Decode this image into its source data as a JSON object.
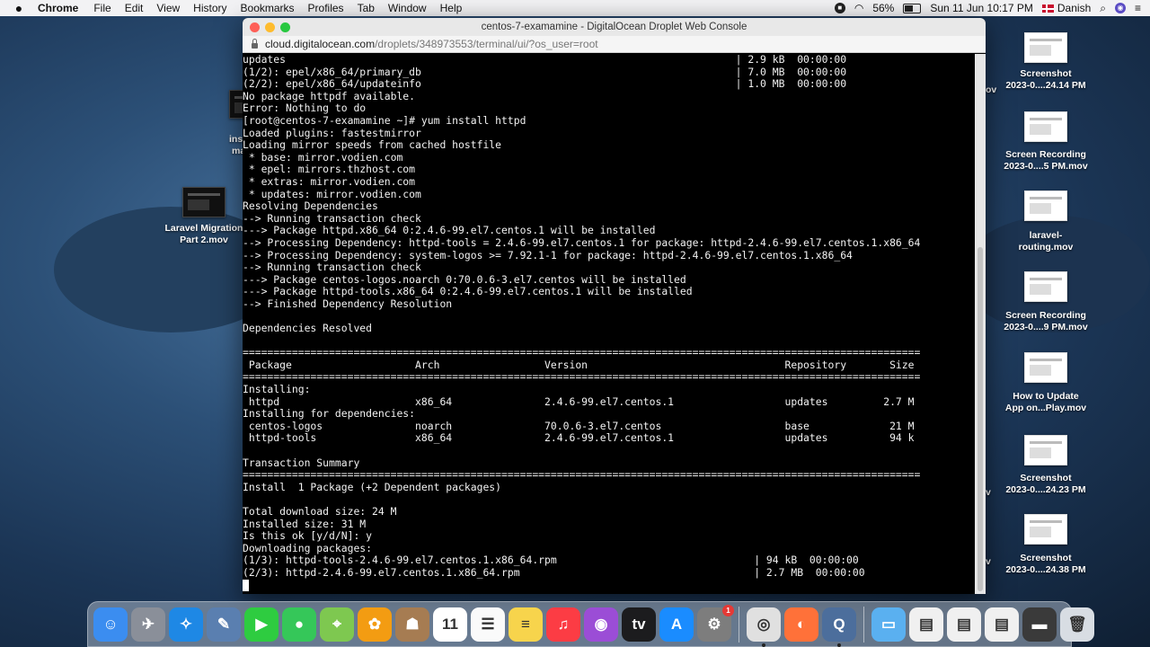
{
  "menubar": {
    "apple_icon": "apple-logo",
    "app_name": "Chrome",
    "menus": [
      "File",
      "Edit",
      "View",
      "History",
      "Bookmarks",
      "Profiles",
      "Tab",
      "Window",
      "Help"
    ],
    "battery": "56%",
    "datetime": "Sun 11 Jun  10:17 PM",
    "input_source": "Danish"
  },
  "window": {
    "title": "centos-7-examamine - DigitalOcean Droplet Web Console",
    "url_host": "cloud.digitalocean.com",
    "url_path": "/droplets/348973553/terminal/ui/?os_user=root"
  },
  "terminal": {
    "lines": [
      "updates                                                                         | 2.9 kB  00:00:00",
      "(1/2): epel/x86_64/primary_db                                                   | 7.0 MB  00:00:00",
      "(2/2): epel/x86_64/updateinfo                                                   | 1.0 MB  00:00:00",
      "No package httpdf available.",
      "Error: Nothing to do",
      "[root@centos-7-examamine ~]# yum install httpd",
      "Loaded plugins: fastestmirror",
      "Loading mirror speeds from cached hostfile",
      " * base: mirror.vodien.com",
      " * epel: mirrors.thzhost.com",
      " * extras: mirror.vodien.com",
      " * updates: mirror.vodien.com",
      "Resolving Dependencies",
      "--> Running transaction check",
      "---> Package httpd.x86_64 0:2.4.6-99.el7.centos.1 will be installed",
      "--> Processing Dependency: httpd-tools = 2.4.6-99.el7.centos.1 for package: httpd-2.4.6-99.el7.centos.1.x86_64",
      "--> Processing Dependency: system-logos >= 7.92.1-1 for package: httpd-2.4.6-99.el7.centos.1.x86_64",
      "--> Running transaction check",
      "---> Package centos-logos.noarch 0:70.0.6-3.el7.centos will be installed",
      "---> Package httpd-tools.x86_64 0:2.4.6-99.el7.centos.1 will be installed",
      "--> Finished Dependency Resolution",
      "",
      "Dependencies Resolved",
      "",
      "==============================================================================================================",
      " Package                    Arch                 Version                                Repository       Size",
      "==============================================================================================================",
      "Installing:",
      " httpd                      x86_64               2.4.6-99.el7.centos.1                  updates         2.7 M",
      "Installing for dependencies:",
      " centos-logos               noarch               70.0.6-3.el7.centos                    base             21 M",
      " httpd-tools                x86_64               2.4.6-99.el7.centos.1                  updates          94 k",
      "",
      "Transaction Summary",
      "==============================================================================================================",
      "Install  1 Package (+2 Dependent packages)",
      "",
      "Total download size: 24 M",
      "Installed size: 31 M",
      "Is this ok [y/d/N]: y",
      "Downloading packages:",
      "(1/3): httpd-tools-2.4.6-99.el7.centos.1.x86_64.rpm                                | 94 kB  00:00:00",
      "(2/3): httpd-2.4.6-99.el7.centos.1.x86_64.rpm                                      | 2.7 MB  00:00:00"
    ]
  },
  "desktop": {
    "left_items": [
      {
        "label1": "Laravel Migration",
        "label2": "Part 2.mov"
      }
    ],
    "left_partial": [
      "ins",
      "ma"
    ],
    "right_items": [
      {
        "label1": "Screenshot",
        "label2": "2023-0....24.14 PM"
      },
      {
        "label1": "Screen Recording",
        "label2": "2023-0....5 PM.mov"
      },
      {
        "label1": "laravel-",
        "label2": "routing.mov"
      },
      {
        "label1": "Screen Recording",
        "label2": "2023-0....9 PM.mov"
      },
      {
        "label1": "How to Update",
        "label2": "App on...Play.mov"
      },
      {
        "label1": "Screenshot",
        "label2": "2023-0....24.23 PM"
      },
      {
        "label1": "Screenshot",
        "label2": "2023-0....24.38 PM"
      }
    ],
    "right_partial": [
      "ov",
      "v",
      "v"
    ]
  },
  "dock": {
    "apps": [
      {
        "name": "finder-icon",
        "color": "#3b8df0",
        "glyph": "☺"
      },
      {
        "name": "launchpad-icon",
        "color": "#8a8f99",
        "glyph": "✈"
      },
      {
        "name": "safari-icon",
        "color": "#1e88e5",
        "glyph": "✧"
      },
      {
        "name": "preview-icon",
        "color": "#5a7fb0",
        "glyph": "✎"
      },
      {
        "name": "facetime-icon",
        "color": "#2ecc40",
        "glyph": "▶"
      },
      {
        "name": "messages-icon",
        "color": "#35c759",
        "glyph": "●"
      },
      {
        "name": "maps-icon",
        "color": "#7ec850",
        "glyph": "⌖"
      },
      {
        "name": "photos-icon",
        "color": "#f39c12",
        "glyph": "✿"
      },
      {
        "name": "contacts-icon",
        "color": "#a67c52",
        "glyph": "☗"
      },
      {
        "name": "calendar-icon",
        "color": "#ffffff",
        "glyph": "11"
      },
      {
        "name": "reminders-icon",
        "color": "#fafafa",
        "glyph": "☰"
      },
      {
        "name": "notes-icon",
        "color": "#f7d44c",
        "glyph": "≡"
      },
      {
        "name": "music-icon",
        "color": "#fc3c44",
        "glyph": "♫"
      },
      {
        "name": "podcasts-icon",
        "color": "#9b4dd6",
        "glyph": "◉"
      },
      {
        "name": "tv-icon",
        "color": "#1c1c1e",
        "glyph": "tv"
      },
      {
        "name": "app-store-icon",
        "color": "#1a8cff",
        "glyph": "A"
      },
      {
        "name": "system-preferences-icon",
        "color": "#7d7d7d",
        "glyph": "⚙",
        "badge": "1"
      }
    ],
    "apps2": [
      {
        "name": "chrome-icon",
        "color": "#e0e0e0",
        "glyph": "◎",
        "running": true
      },
      {
        "name": "firefox-icon",
        "color": "#ff7139",
        "glyph": "◐"
      },
      {
        "name": "quicktime-icon",
        "color": "#4c6e9c",
        "glyph": "Q",
        "running": true
      }
    ],
    "apps3": [
      {
        "name": "folder-icon",
        "color": "#5ab0f0",
        "glyph": "▭"
      },
      {
        "name": "recent-file-icon-1",
        "color": "#f0f0f0",
        "glyph": "▤"
      },
      {
        "name": "recent-file-icon-2",
        "color": "#f0f0f0",
        "glyph": "▤"
      },
      {
        "name": "recent-file-icon-3",
        "color": "#f0f0f0",
        "glyph": "▤"
      },
      {
        "name": "recent-file-icon-4",
        "color": "#3a3a3a",
        "glyph": "▬"
      },
      {
        "name": "trash-icon",
        "color": "#d8dde3",
        "glyph": "🗑"
      }
    ]
  }
}
